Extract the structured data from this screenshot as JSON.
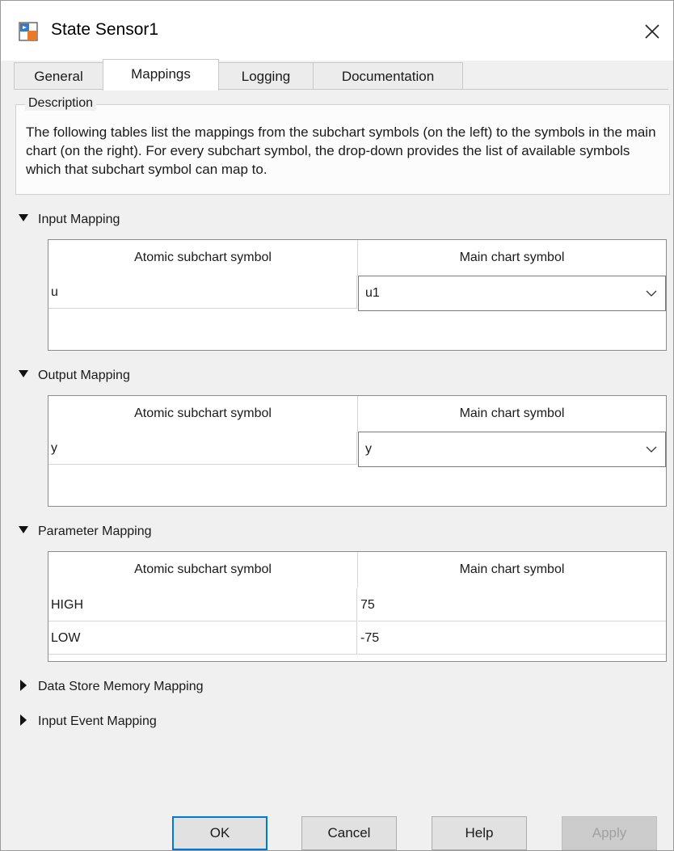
{
  "window": {
    "title": "State Sensor1",
    "icon": "simulink-block-icon",
    "close_icon": "close-icon"
  },
  "tabs": [
    {
      "label": "General",
      "active": false
    },
    {
      "label": "Mappings",
      "active": true
    },
    {
      "label": "Logging",
      "active": false
    },
    {
      "label": "Documentation",
      "active": false
    }
  ],
  "description": {
    "label": "Description",
    "text": "The following tables list the mappings from the subchart symbols (on the left) to the symbols in the main chart (on the right). For every subchart symbol, the drop-down provides the list of available symbols which that subchart symbol can map to."
  },
  "sections": {
    "input": {
      "title": "Input Mapping",
      "expanded": true,
      "columns": [
        "Atomic subchart symbol",
        "Main chart symbol"
      ],
      "rows": [
        {
          "subchart": "u",
          "main": "u1"
        }
      ]
    },
    "output": {
      "title": "Output Mapping",
      "expanded": true,
      "columns": [
        "Atomic subchart symbol",
        "Main chart symbol"
      ],
      "rows": [
        {
          "subchart": "y",
          "main": "y"
        }
      ]
    },
    "parameter": {
      "title": "Parameter Mapping",
      "expanded": true,
      "columns": [
        "Atomic subchart symbol",
        "Main chart symbol"
      ],
      "rows": [
        {
          "subchart": "HIGH",
          "main": "75"
        },
        {
          "subchart": "LOW",
          "main": "-75"
        }
      ]
    },
    "data_store": {
      "title": "Data Store Memory Mapping",
      "expanded": false
    },
    "input_event": {
      "title": "Input Event Mapping",
      "expanded": false
    }
  },
  "buttons": {
    "ok": "OK",
    "cancel": "Cancel",
    "help": "Help",
    "apply": "Apply"
  },
  "colors": {
    "accent": "#0078d7",
    "background": "#f0f0f0"
  }
}
